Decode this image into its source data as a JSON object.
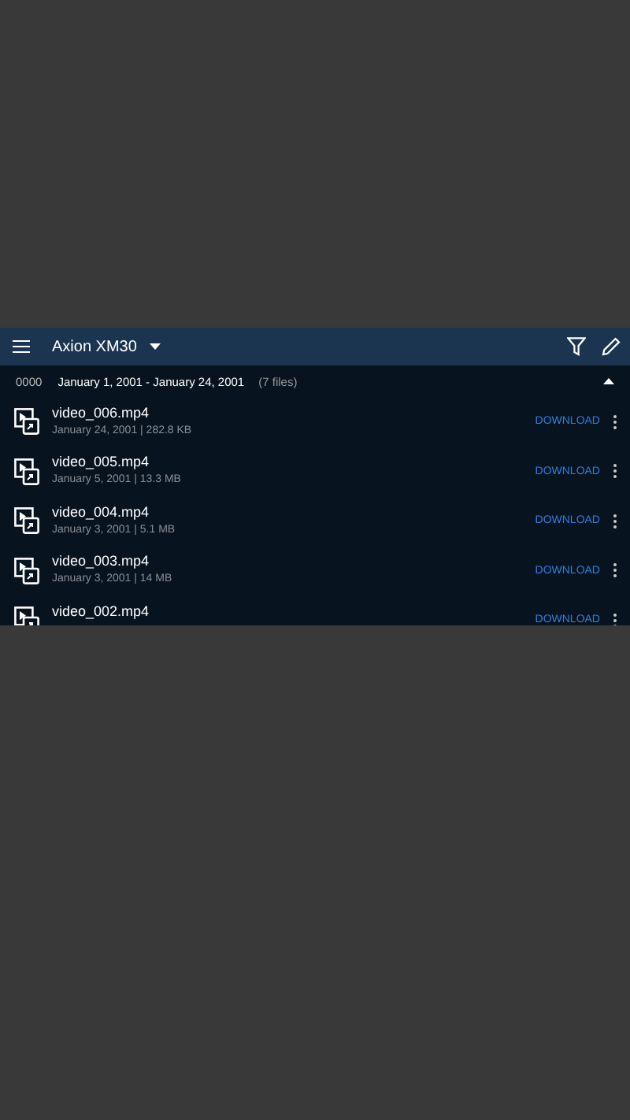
{
  "toolbar": {
    "title": "Axion XM30"
  },
  "group": {
    "code": "0000",
    "range": "January 1, 2001 - January 24, 2001",
    "count": "(7 files)",
    "expanded": true
  },
  "files": [
    {
      "name": "video_006.mp4",
      "meta": "January 24, 2001 | 282.8 KB",
      "action": "DOWNLOAD"
    },
    {
      "name": "video_005.mp4",
      "meta": "January 5, 2001 | 13.3 MB",
      "action": "DOWNLOAD"
    },
    {
      "name": "video_004.mp4",
      "meta": "January 3, 2001 | 5.1 MB",
      "action": "DOWNLOAD"
    },
    {
      "name": "video_003.mp4",
      "meta": "January 3, 2001 | 14 MB",
      "action": "DOWNLOAD"
    },
    {
      "name": "video_002.mp4",
      "action": "DOWNLOAD"
    }
  ]
}
